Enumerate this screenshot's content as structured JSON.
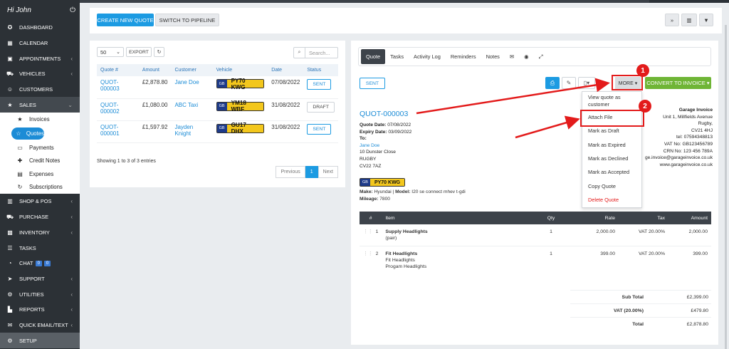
{
  "user": {
    "greeting": "Hi John"
  },
  "sidebar": {
    "items": [
      {
        "label": "DASHBOARD",
        "icon": "dashboard-icon",
        "glyph": "✪"
      },
      {
        "label": "CALENDAR",
        "icon": "calendar-icon",
        "glyph": "▦"
      },
      {
        "label": "APPOINTMENTS",
        "icon": "appointments-icon",
        "glyph": "▣"
      },
      {
        "label": "VEHICLES",
        "icon": "car-icon",
        "glyph": "⛟"
      },
      {
        "label": "CUSTOMERS",
        "icon": "user-icon",
        "glyph": "☺"
      },
      {
        "label": "SALES",
        "icon": "star-icon",
        "glyph": "★"
      }
    ],
    "sub": [
      {
        "label": "Invoices",
        "glyph": "★"
      },
      {
        "label": "Quotes",
        "glyph": "☆"
      },
      {
        "label": "Payments",
        "glyph": "▭"
      },
      {
        "label": "Credit Notes",
        "glyph": "✚"
      },
      {
        "label": "Expenses",
        "glyph": "▤"
      },
      {
        "label": "Subscriptions",
        "glyph": "↻"
      }
    ],
    "lower": [
      {
        "label": "SHOP & POS",
        "glyph": "▥"
      },
      {
        "label": "PURCHASE",
        "glyph": "⛟"
      },
      {
        "label": "INVENTORY",
        "glyph": "▩"
      },
      {
        "label": "TASKS",
        "glyph": "☰"
      },
      {
        "label": "CHAT",
        "glyph": "◔",
        "badges": [
          "0",
          "0"
        ]
      },
      {
        "label": "SUPPORT",
        "glyph": "➤"
      },
      {
        "label": "UTILITIES",
        "glyph": "⚙"
      },
      {
        "label": "REPORTS",
        "glyph": "▙"
      },
      {
        "label": "QUICK EMAIL/TEXT",
        "glyph": "✉"
      },
      {
        "label": "SETUP",
        "glyph": "⚙"
      }
    ]
  },
  "toolbar": {
    "create_label": "CREATE NEW QUOTE",
    "switch_label": "SWITCH TO PIPELINE"
  },
  "list": {
    "page_size": "50",
    "export_label": "EXPORT",
    "search_placeholder": "Search...",
    "columns": [
      "Quote #",
      "Amount",
      "Customer",
      "Vehicle",
      "Date",
      "Status"
    ],
    "rows": [
      {
        "quote": "QUOT-000003",
        "amount": "£2,878.80",
        "customer": "Jane Doe",
        "plate_country": "GB",
        "plate": "PY70 KWG",
        "date": "07/08/2022",
        "status": "SENT"
      },
      {
        "quote": "QUOT-000002",
        "amount": "£1,080.00",
        "customer": "ABC Taxi",
        "plate_country": "GB",
        "plate": "YM18 WBF",
        "date": "31/08/2022",
        "status": "DRAFT"
      },
      {
        "quote": "QUOT-000001",
        "amount": "£1,597.92",
        "customer": "Jayden Knight",
        "plate_country": "GB",
        "plate": "GU17 DHX",
        "date": "31/08/2022",
        "status": "SENT"
      }
    ],
    "showing": "Showing 1 to 3 of 3 entries",
    "pager": {
      "prev": "Previous",
      "current": "1",
      "next": "Next"
    }
  },
  "detail": {
    "tabs": [
      "Quote",
      "Tasks",
      "Activity Log",
      "Reminders",
      "Notes"
    ],
    "status": "SENT",
    "more_label": "MORE ▾",
    "convert_label": "CONVERT TO INVOICE ▾",
    "menu": [
      "View quote as customer",
      "Attach File",
      "Mark as Draft",
      "Mark as Expired",
      "Mark as Declined",
      "Mark as Accepted",
      "Copy Quote",
      "Delete Quote"
    ],
    "quote_number": "QUOT-000003",
    "quote_date_label": "Quote Date:",
    "quote_date": "07/08/2022",
    "expiry_label": "Expiry Date:",
    "expiry": "03/09/2022",
    "to_label": "To:",
    "customer": "Jane Doe",
    "address": [
      "10 Dunster Close",
      "RUGBY",
      "CV22 7AZ"
    ],
    "plate_country": "GB",
    "plate": "PY70 KWG",
    "make_label": "Make:",
    "make": "Hyundai",
    "model_label": "Model:",
    "model": "I20 se connect mhev t-gdi",
    "mileage_label": "Mileage:",
    "mileage": "7800",
    "company": {
      "name": "Garage Invoice",
      "lines": [
        "Unit 1, Millfields Avenue",
        "Rugby,",
        "CV21 4HJ",
        "tel: 07594348813",
        "VAT No: GB123456789",
        "CRN No: 123 456 789A",
        "ge.invoice@garageinvoice.co.uk",
        "www.garageinvoice.co.uk"
      ]
    },
    "item_columns": [
      "#",
      "Item",
      "Qty",
      "Rate",
      "Tax",
      "Amount"
    ],
    "items": [
      {
        "n": "1",
        "name": "Supply Headlights",
        "desc": [
          "(pair)"
        ],
        "qty": "1",
        "rate": "2,000.00",
        "tax": "VAT 20.00%",
        "amount": "2,000.00"
      },
      {
        "n": "2",
        "name": "Fit Headlights",
        "desc": [
          "Fit Headlights",
          "Progam Headlights"
        ],
        "qty": "1",
        "rate": "399.00",
        "tax": "VAT 20.00%",
        "amount": "399.00"
      }
    ],
    "totals": [
      {
        "label": "Sub Total",
        "value": "£2,399.00"
      },
      {
        "label": "VAT (20.00%)",
        "value": "£479.80"
      },
      {
        "label": "Total",
        "value": "£2,878.80"
      }
    ]
  },
  "annotations": {
    "step1": "1",
    "step2": "2",
    "color": "#e31b1b"
  }
}
